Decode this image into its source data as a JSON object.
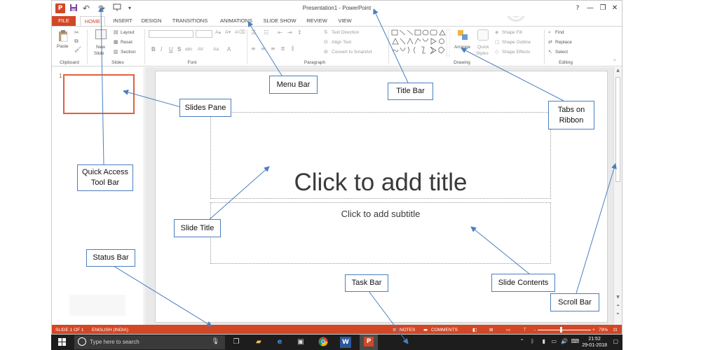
{
  "window": {
    "title": "Presentation1 - PowerPoint",
    "app_icon_glyph": "P",
    "undo_glyph": "↶",
    "redo_glyph": "↷",
    "help_glyph": "?",
    "minimize_glyph": "—",
    "restore_glyph": "❐",
    "close_glyph": "✕"
  },
  "tabs": [
    "FILE",
    "HOME",
    "INSERT",
    "DESIGN",
    "TRANSITIONS",
    "ANIMATIONS",
    "SLIDE SHOW",
    "REVIEW",
    "VIEW"
  ],
  "ribbon": {
    "clipboard": {
      "paste": "Paste",
      "label": "Clipboard"
    },
    "slides": {
      "new_slide_1": "New",
      "new_slide_2": "Slide",
      "layout": "Layout",
      "reset": "Reset",
      "section": "Section",
      "label": "Slides"
    },
    "font": {
      "label": "Font",
      "bold": "B",
      "italic": "I",
      "underline": "U",
      "strike": "S",
      "shadow": "abc",
      "spacing": "AV",
      "case": "Aa",
      "color": "A"
    },
    "paragraph": {
      "label": "Paragraph",
      "text_direction": "Text Direction",
      "align_text": "Align Text",
      "smartart": "Convert to SmartArt"
    },
    "drawing": {
      "label": "Drawing",
      "arrange": "Arrange",
      "quick_1": "Quick",
      "quick_2": "Styles",
      "shape_fill": "Shape Fill",
      "shape_outline": "Shape Outline",
      "shape_effects": "Shape Effects"
    },
    "editing": {
      "label": "Editing",
      "find": "Find",
      "replace": "Replace",
      "select": "Select"
    }
  },
  "slides_pane": {
    "slide_number": "1"
  },
  "slide": {
    "title_placeholder": "Click to add title",
    "subtitle_placeholder": "Click to add subtitle"
  },
  "status_bar": {
    "slide_info": "SLIDE 1 OF 1",
    "language": "ENGLISH (INDIA)",
    "notes": "NOTES",
    "comments": "COMMENTS",
    "zoom_out": "-",
    "zoom_in": "+",
    "zoom": "79%"
  },
  "taskbar": {
    "search_placeholder": "Type here to search",
    "time": "21:52",
    "date": "29-01-2018"
  },
  "annotations": {
    "menu_bar": "Menu Bar",
    "title_bar": "Title Bar",
    "slides_pane": "Slides Pane",
    "tabs_on_ribbon": "Tabs on Ribbon",
    "quick_access": "Quick Access Tool Bar",
    "slide_title": "Slide Title",
    "status_bar": "Status Bar",
    "task_bar": "Task Bar",
    "slide_contents": "Slide Contents",
    "scroll_bar": "Scroll Bar"
  },
  "colors": {
    "accent": "#d24726",
    "annotation_border": "#4a7fbf",
    "taskbar": "#1d1d1d"
  }
}
